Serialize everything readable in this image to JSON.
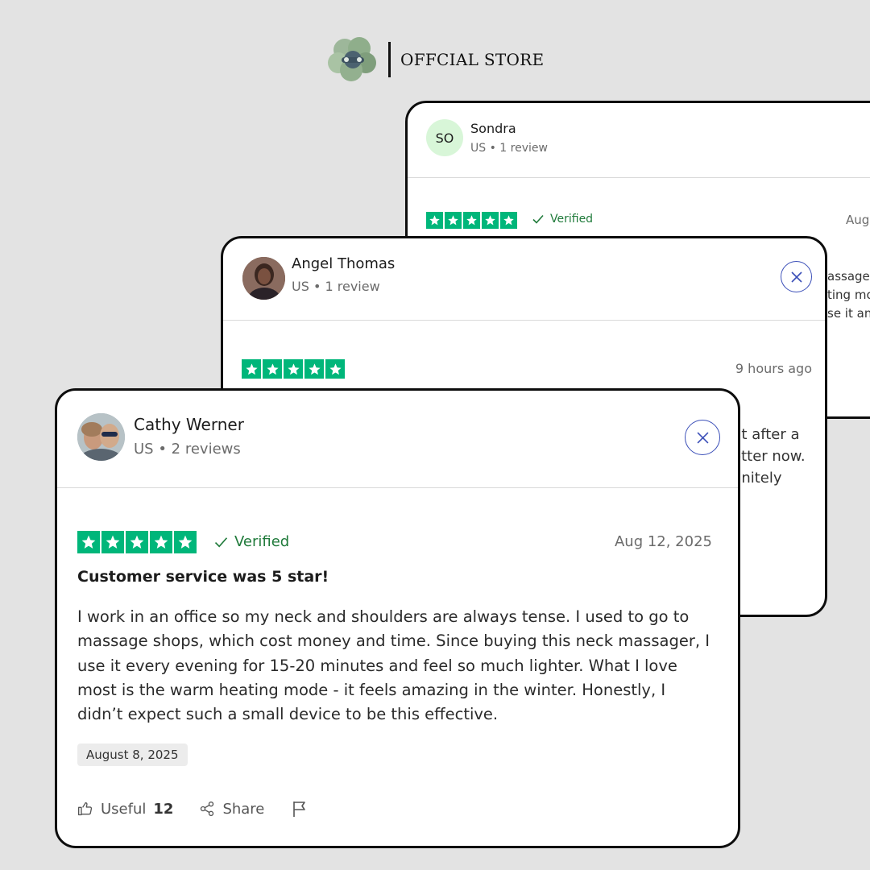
{
  "header": {
    "store_label": "OFFCIAL STORE"
  },
  "colors": {
    "star_green": "#00b67a",
    "verified_green": "#1f7a3a",
    "close_blue": "#3b4fb8"
  },
  "reviews": [
    {
      "initials": "SO",
      "name": "Sondra",
      "meta": "US • 1 review",
      "verified": "Verified",
      "date_right": "Aug",
      "rating": 5,
      "partial_lines": [
        "assage",
        "ting mo",
        "se it an"
      ]
    },
    {
      "name": "Angel Thomas",
      "meta": "US • 1 review",
      "date_right": "9 hours ago",
      "rating": 5,
      "partial_lines": [
        "ut after a",
        "etter now.",
        "finitely"
      ]
    },
    {
      "name": "Cathy Werner",
      "meta": "US • 2 reviews",
      "verified": "Verified",
      "date_right": "Aug 12, 2025",
      "rating": 5,
      "title": "Customer service was 5 star!",
      "body_lines": [
        "I work in an office so my neck and shoulders are always tense. I used to go to",
        "massage shops, which cost money and time. Since buying this neck massager, I",
        "use it every evening for 15-20 minutes and feel so much lighter. What I love",
        "most is the warm heating mode - it feels amazing in the winter. Honestly, I",
        "didn’t expect such a small device to be this effective."
      ],
      "experience_date": "August 8, 2025",
      "useful_label": "Useful",
      "useful_count": "12",
      "share_label": "Share"
    }
  ]
}
